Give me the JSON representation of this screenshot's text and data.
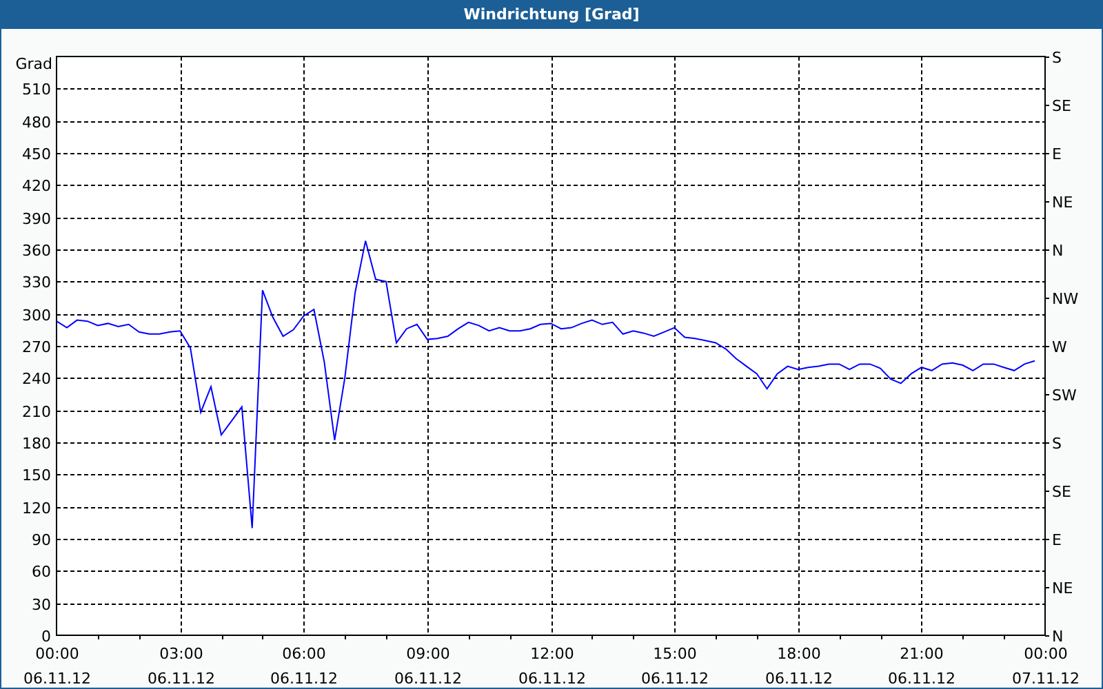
{
  "window": {
    "title": "Windrichtung [Grad]"
  },
  "chart": {
    "chart_data": {
      "type": "line",
      "grid": true,
      "ylabel": "Grad",
      "ylim": [
        0,
        540
      ],
      "yticks": [
        0,
        30,
        60,
        90,
        120,
        150,
        180,
        210,
        240,
        270,
        300,
        330,
        360,
        390,
        420,
        450,
        480,
        510
      ],
      "categories": [
        "00:00 06.11.12",
        null,
        null,
        null,
        null,
        null,
        null,
        null,
        null,
        null,
        null,
        null,
        "03:00 06.11.12",
        null,
        null,
        null,
        null,
        null,
        null,
        null,
        null,
        null,
        null,
        null,
        "06:00 06.11.12",
        null,
        null,
        null,
        null,
        null,
        null,
        null,
        null,
        null,
        null,
        null,
        "09:00 06.11.12",
        null,
        null,
        null,
        null,
        null,
        null,
        null,
        null,
        null,
        null,
        null,
        "12:00 06.11.12",
        null,
        null,
        null,
        null,
        null,
        null,
        null,
        null,
        null,
        null,
        null,
        "15:00 06.11.12",
        null,
        null,
        null,
        null,
        null,
        null,
        null,
        null,
        null,
        null,
        null,
        "18:00 06.11.12",
        null,
        null,
        null,
        null,
        null,
        null,
        null,
        null,
        null,
        null,
        null,
        "21:00 06.11.12",
        null,
        null,
        null,
        null,
        null,
        null,
        null,
        null,
        null,
        null,
        null,
        "00:00 07.11.12"
      ],
      "series": [
        {
          "color": "#0000ff",
          "values": [
            293,
            287,
            294,
            293,
            289,
            291,
            288,
            290,
            283,
            281,
            281,
            283,
            284,
            268,
            208,
            232,
            187,
            200,
            213,
            100,
            322,
            297,
            279,
            285,
            298,
            304,
            255,
            182,
            240,
            320,
            368,
            332,
            330,
            273,
            286,
            290,
            276,
            277,
            279,
            286,
            292,
            289,
            284,
            287,
            284,
            284,
            286,
            290,
            291,
            286,
            287,
            291,
            294,
            290,
            292,
            281,
            284,
            282,
            279,
            283,
            287,
            278,
            277,
            275,
            273,
            267,
            258,
            251,
            244,
            230,
            244,
            251,
            248,
            250,
            251,
            253,
            253,
            248,
            253,
            253,
            249,
            239,
            235,
            244,
            250,
            247,
            253,
            254,
            252,
            247,
            253,
            253,
            250,
            247,
            253,
            256,
            null
          ]
        }
      ]
    },
    "right_axis_labels": [
      "S",
      "SE",
      "E",
      "NE",
      "N",
      "NW",
      "W",
      "SW",
      "S",
      "SE",
      "E",
      "NE",
      "N"
    ]
  }
}
